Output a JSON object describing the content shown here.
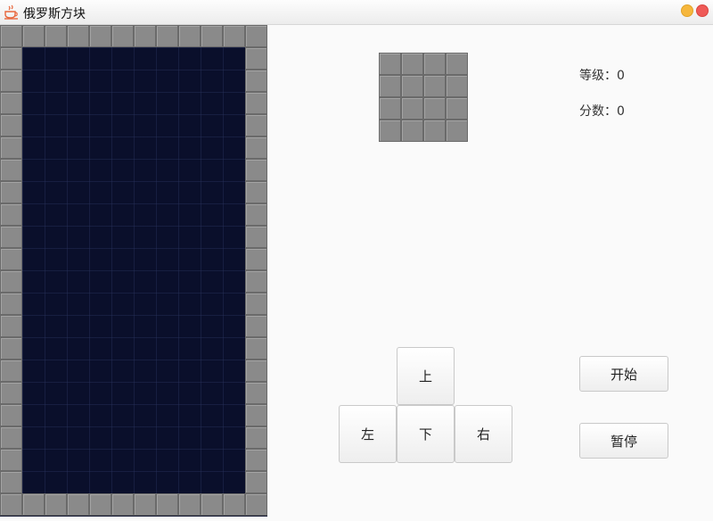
{
  "window": {
    "title": "俄罗斯方块",
    "app_icon": "java-cup-icon"
  },
  "board": {
    "columns": 12,
    "rows": 22,
    "wall_color": "#8a8a8a",
    "background_color": "#0a0f2b"
  },
  "next_piece": {
    "columns": 4,
    "rows": 4
  },
  "stats": {
    "level_label": "等级：",
    "level_value": "0",
    "score_label": "分数：",
    "score_value": "0"
  },
  "controls": {
    "up": "上",
    "left": "左",
    "down": "下",
    "right": "右",
    "start": "开始",
    "pause": "暂停"
  }
}
